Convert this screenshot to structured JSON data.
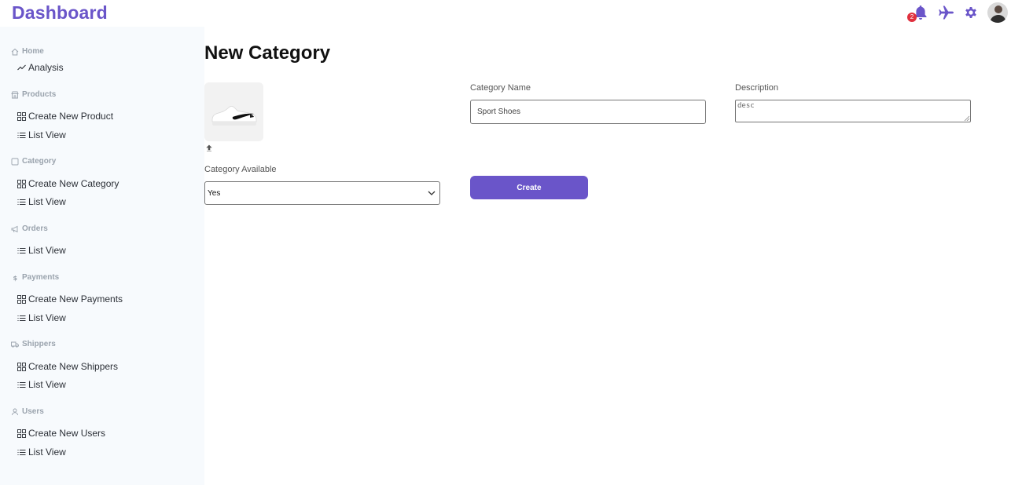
{
  "header": {
    "brand": "Dashboard",
    "notifications_count": "2",
    "accent_color": "#6a55c9"
  },
  "sidebar": {
    "home": {
      "title": "Home",
      "items": [
        "Analysis"
      ]
    },
    "products": {
      "title": "Products",
      "items": [
        "Create New Product",
        "List View"
      ]
    },
    "category": {
      "title": "Category",
      "items": [
        "Create New Category",
        "List View"
      ]
    },
    "orders": {
      "title": "Orders",
      "items": [
        "List View"
      ]
    },
    "payments": {
      "title": "Payments",
      "items": [
        "Create New Payments",
        "List View"
      ]
    },
    "shippers": {
      "title": "Shippers",
      "items": [
        "Create New Shippers",
        "List View"
      ]
    },
    "users": {
      "title": "Users",
      "items": [
        "Create New Users",
        "List View"
      ]
    }
  },
  "main": {
    "title": "New Category",
    "category_name_label": "Category Name",
    "category_name_value": "Sport Shoes",
    "description_label": "Description",
    "description_value": "desc",
    "available_label": "Category Available",
    "available_value": "Yes",
    "create_button": "Create"
  }
}
